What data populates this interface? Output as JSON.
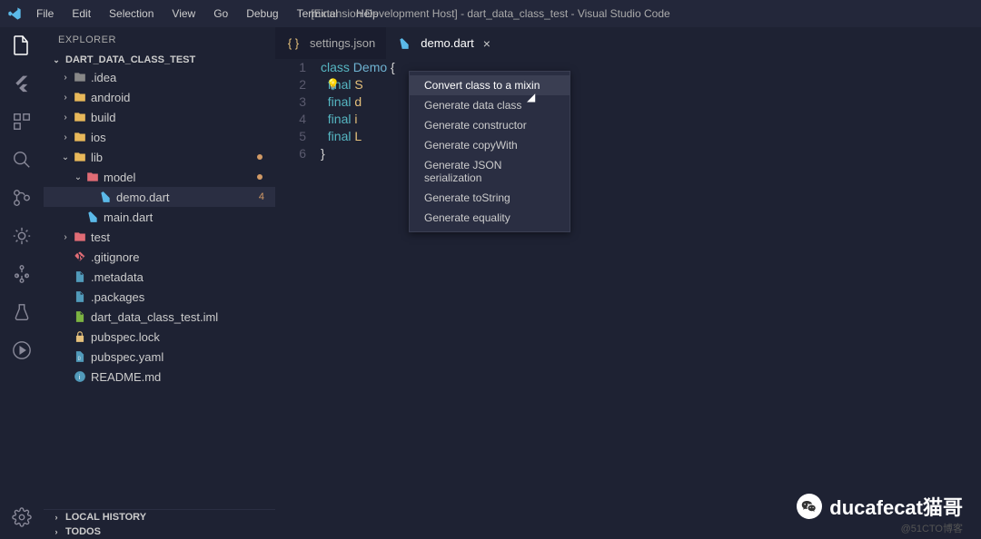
{
  "titlebar": {
    "menus": [
      "File",
      "Edit",
      "Selection",
      "View",
      "Go",
      "Debug",
      "Terminal",
      "Help"
    ],
    "title": "[Extension Development Host] - dart_data_class_test - Visual Studio Code"
  },
  "sidebar": {
    "title": "EXPLORER",
    "project_name": "DART_DATA_CLASS_TEST",
    "tree": [
      {
        "depth": 0,
        "chev": "›",
        "icon": "folder-dim",
        "label": ".idea"
      },
      {
        "depth": 0,
        "chev": "›",
        "icon": "folder",
        "label": "android"
      },
      {
        "depth": 0,
        "chev": "›",
        "icon": "folder",
        "label": "build"
      },
      {
        "depth": 0,
        "chev": "›",
        "icon": "folder",
        "label": "ios"
      },
      {
        "depth": 0,
        "chev": "⌄",
        "icon": "folder",
        "label": "lib",
        "dot": true
      },
      {
        "depth": 1,
        "chev": "⌄",
        "icon": "folder-red",
        "label": "model",
        "dot": true
      },
      {
        "depth": 2,
        "chev": "",
        "icon": "dart",
        "label": "demo.dart",
        "selected": true,
        "badge": "4"
      },
      {
        "depth": 1,
        "chev": "",
        "icon": "dart",
        "label": "main.dart"
      },
      {
        "depth": 0,
        "chev": "›",
        "icon": "folder-red",
        "label": "test"
      },
      {
        "depth": 0,
        "chev": "",
        "icon": "git",
        "label": ".gitignore"
      },
      {
        "depth": 0,
        "chev": "",
        "icon": "file",
        "label": ".metadata"
      },
      {
        "depth": 0,
        "chev": "",
        "icon": "file",
        "label": ".packages"
      },
      {
        "depth": 0,
        "chev": "",
        "icon": "file-green",
        "label": "dart_data_class_test.iml"
      },
      {
        "depth": 0,
        "chev": "",
        "icon": "lock",
        "label": "pubspec.lock"
      },
      {
        "depth": 0,
        "chev": "",
        "icon": "yaml",
        "label": "pubspec.yaml"
      },
      {
        "depth": 0,
        "chev": "",
        "icon": "info",
        "label": "README.md"
      }
    ],
    "bottom_sections": [
      "LOCAL HISTORY",
      "TODOS"
    ]
  },
  "tabs": [
    {
      "icon": "braces",
      "label": "settings.json",
      "active": false
    },
    {
      "icon": "dart",
      "label": "demo.dart",
      "active": true
    }
  ],
  "code": {
    "lines": [
      {
        "n": 1,
        "html": "<span class='kw'>class</span> <span class='type'>Demo</span> <span class='punct'>{</span>"
      },
      {
        "n": 2,
        "html": "  <span class='kw'>final</span> <span class='ident'>S</span>"
      },
      {
        "n": 3,
        "html": "  <span class='kw'>final</span> <span class='ident'>d</span>"
      },
      {
        "n": 4,
        "html": "  <span class='kw'>final</span> <span class='ident'>i</span>"
      },
      {
        "n": 5,
        "html": "  <span class='kw'>final</span> <span class='ident'>L</span>"
      },
      {
        "n": 6,
        "html": "<span class='punct'>}</span>"
      }
    ]
  },
  "context_menu": [
    "Convert class to a mixin",
    "Generate data class",
    "Generate constructor",
    "Generate copyWith",
    "Generate JSON serialization",
    "Generate toString",
    "Generate equality"
  ],
  "context_menu_highlighted": 0,
  "watermark": {
    "text": "ducafecat猫哥",
    "sub": "@51CTO博客"
  }
}
